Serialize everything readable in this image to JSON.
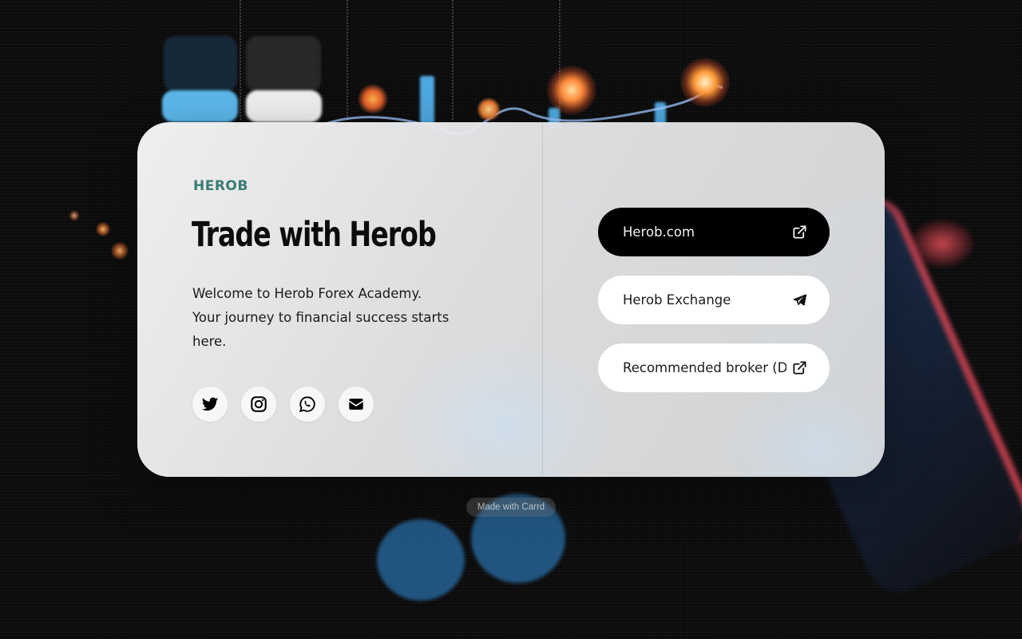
{
  "brand": "HEROB",
  "title": "Trade with Herob",
  "description": {
    "line1": "Welcome to Herob Forex Academy.",
    "line2": "Your journey to financial success starts here."
  },
  "socials": [
    {
      "name": "twitter",
      "icon": "twitter-icon"
    },
    {
      "name": "instagram",
      "icon": "instagram-icon"
    },
    {
      "name": "whatsapp",
      "icon": "whatsapp-icon"
    },
    {
      "name": "email",
      "icon": "envelope-icon"
    }
  ],
  "links": [
    {
      "label": "Herob.com",
      "icon": "external-link-icon",
      "style": "dark"
    },
    {
      "label": "Herob Exchange",
      "icon": "paper-plane-icon",
      "style": "light"
    },
    {
      "label": "Recommended broker (D",
      "icon": "external-link-icon",
      "style": "light"
    }
  ],
  "footer": {
    "made_with": "Made with Carrd"
  },
  "colors": {
    "brand_accent": "#3a7b72",
    "primary_button": "#000000",
    "card_background": "#ececec",
    "page_background": "#0b0b0c"
  }
}
